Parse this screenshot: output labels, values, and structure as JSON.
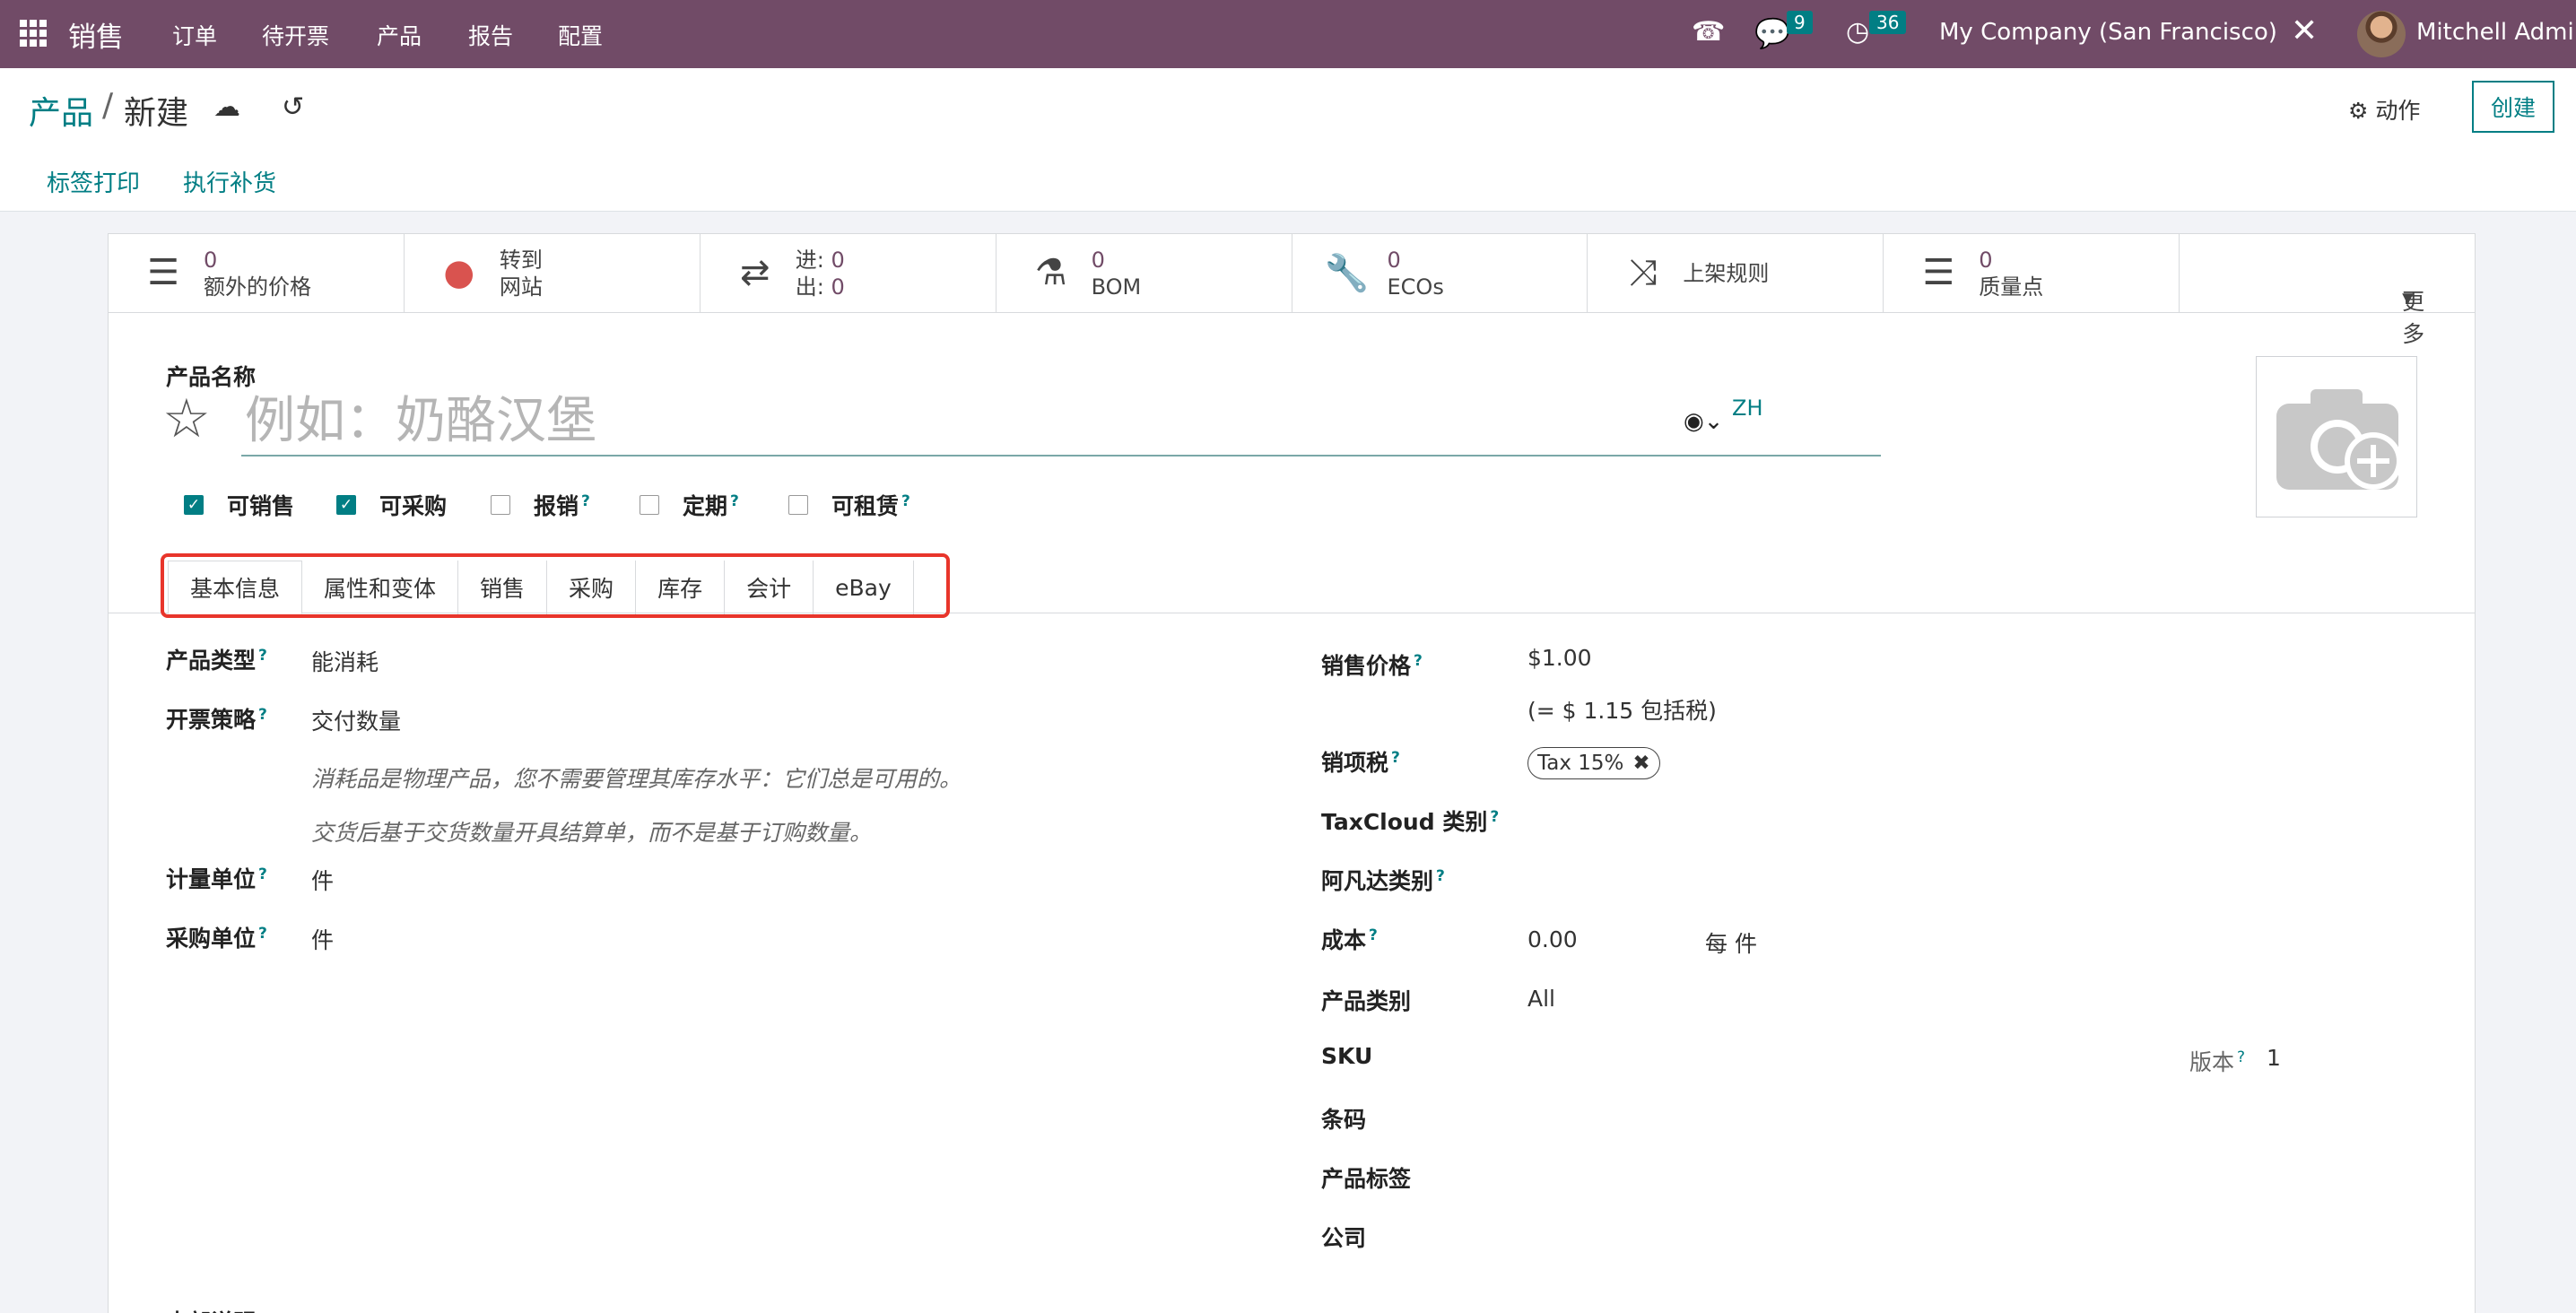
{
  "navbar": {
    "app_name": "销售",
    "menu": [
      "订单",
      "待开票",
      "产品",
      "报告",
      "配置"
    ],
    "messages_count": "9",
    "activities_count": "36",
    "company": "My Company (San Francisco)",
    "user": "Mitchell Admin"
  },
  "control_panel": {
    "breadcrumb_parent": "产品",
    "breadcrumb_separator": "/",
    "breadcrumb_current": "新建",
    "action_label": "动作",
    "create_label": "创建",
    "sub_actions": [
      "标签打印",
      "执行补货"
    ]
  },
  "stat_buttons": [
    {
      "icon": "list-icon",
      "value": "0",
      "label": "额外的价格"
    },
    {
      "icon": "globe-icon",
      "value": "转到",
      "label": "网站"
    },
    {
      "icon": "transfer-icon",
      "in_label": "进:",
      "in_value": "0",
      "out_label": "出:",
      "out_value": "0"
    },
    {
      "icon": "flask-icon",
      "value": "0",
      "label": "BOM"
    },
    {
      "icon": "wrench-icon",
      "value": "0",
      "label": "ECOs"
    },
    {
      "icon": "random-icon",
      "label": "上架规则"
    },
    {
      "icon": "list-icon",
      "value": "0",
      "label": "质量点"
    }
  ],
  "more_label": "更多",
  "form": {
    "name_label": "产品名称",
    "name_placeholder": "例如：奶酪汉堡",
    "name_value": "",
    "lang_code": "ZH",
    "checkboxes": [
      {
        "label": "可销售",
        "checked": true,
        "help": ""
      },
      {
        "label": "可采购",
        "checked": true,
        "help": ""
      },
      {
        "label": "报销",
        "checked": false,
        "help": "?"
      },
      {
        "label": "定期",
        "checked": false,
        "help": "?"
      },
      {
        "label": "可租赁",
        "checked": false,
        "help": "?"
      }
    ],
    "tabs": [
      "基本信息",
      "属性和变体",
      "销售",
      "采购",
      "库存",
      "会计",
      "eBay"
    ],
    "left": {
      "product_type_label": "产品类型",
      "product_type": "能消耗",
      "invoice_policy_label": "开票策略",
      "invoice_policy": "交付数量",
      "note1": "消耗品是物理产品，您不需要管理其库存水平：它们总是可用的。",
      "note2": "交货后基于交货数量开具结算单，而不是基于订购数量。",
      "uom_label": "计量单位",
      "uom": "件",
      "purchase_uom_label": "采购单位",
      "purchase_uom": "件",
      "internal_notes_label": "内部说明"
    },
    "right": {
      "sales_price_label": "销售价格",
      "sales_price": "$1.00",
      "price_with_tax": "(= $ 1.15 包括税)",
      "sales_tax_label": "销项税",
      "sales_tax": "Tax 15%",
      "taxcloud_label": "TaxCloud 类别",
      "avatax_label": "阿凡达类别",
      "cost_label": "成本",
      "cost": "0.00",
      "cost_unit": "每 件",
      "category_label": "产品类别",
      "category": "All",
      "sku_label": "SKU",
      "version_label": "版本",
      "version": "1",
      "barcode_label": "条码",
      "tags_label": "产品标签",
      "company_label": "公司"
    },
    "help_mark": "?"
  },
  "colors": {
    "navbar": "#714b67",
    "accent": "#017e84",
    "highlight": "#e8352b"
  }
}
